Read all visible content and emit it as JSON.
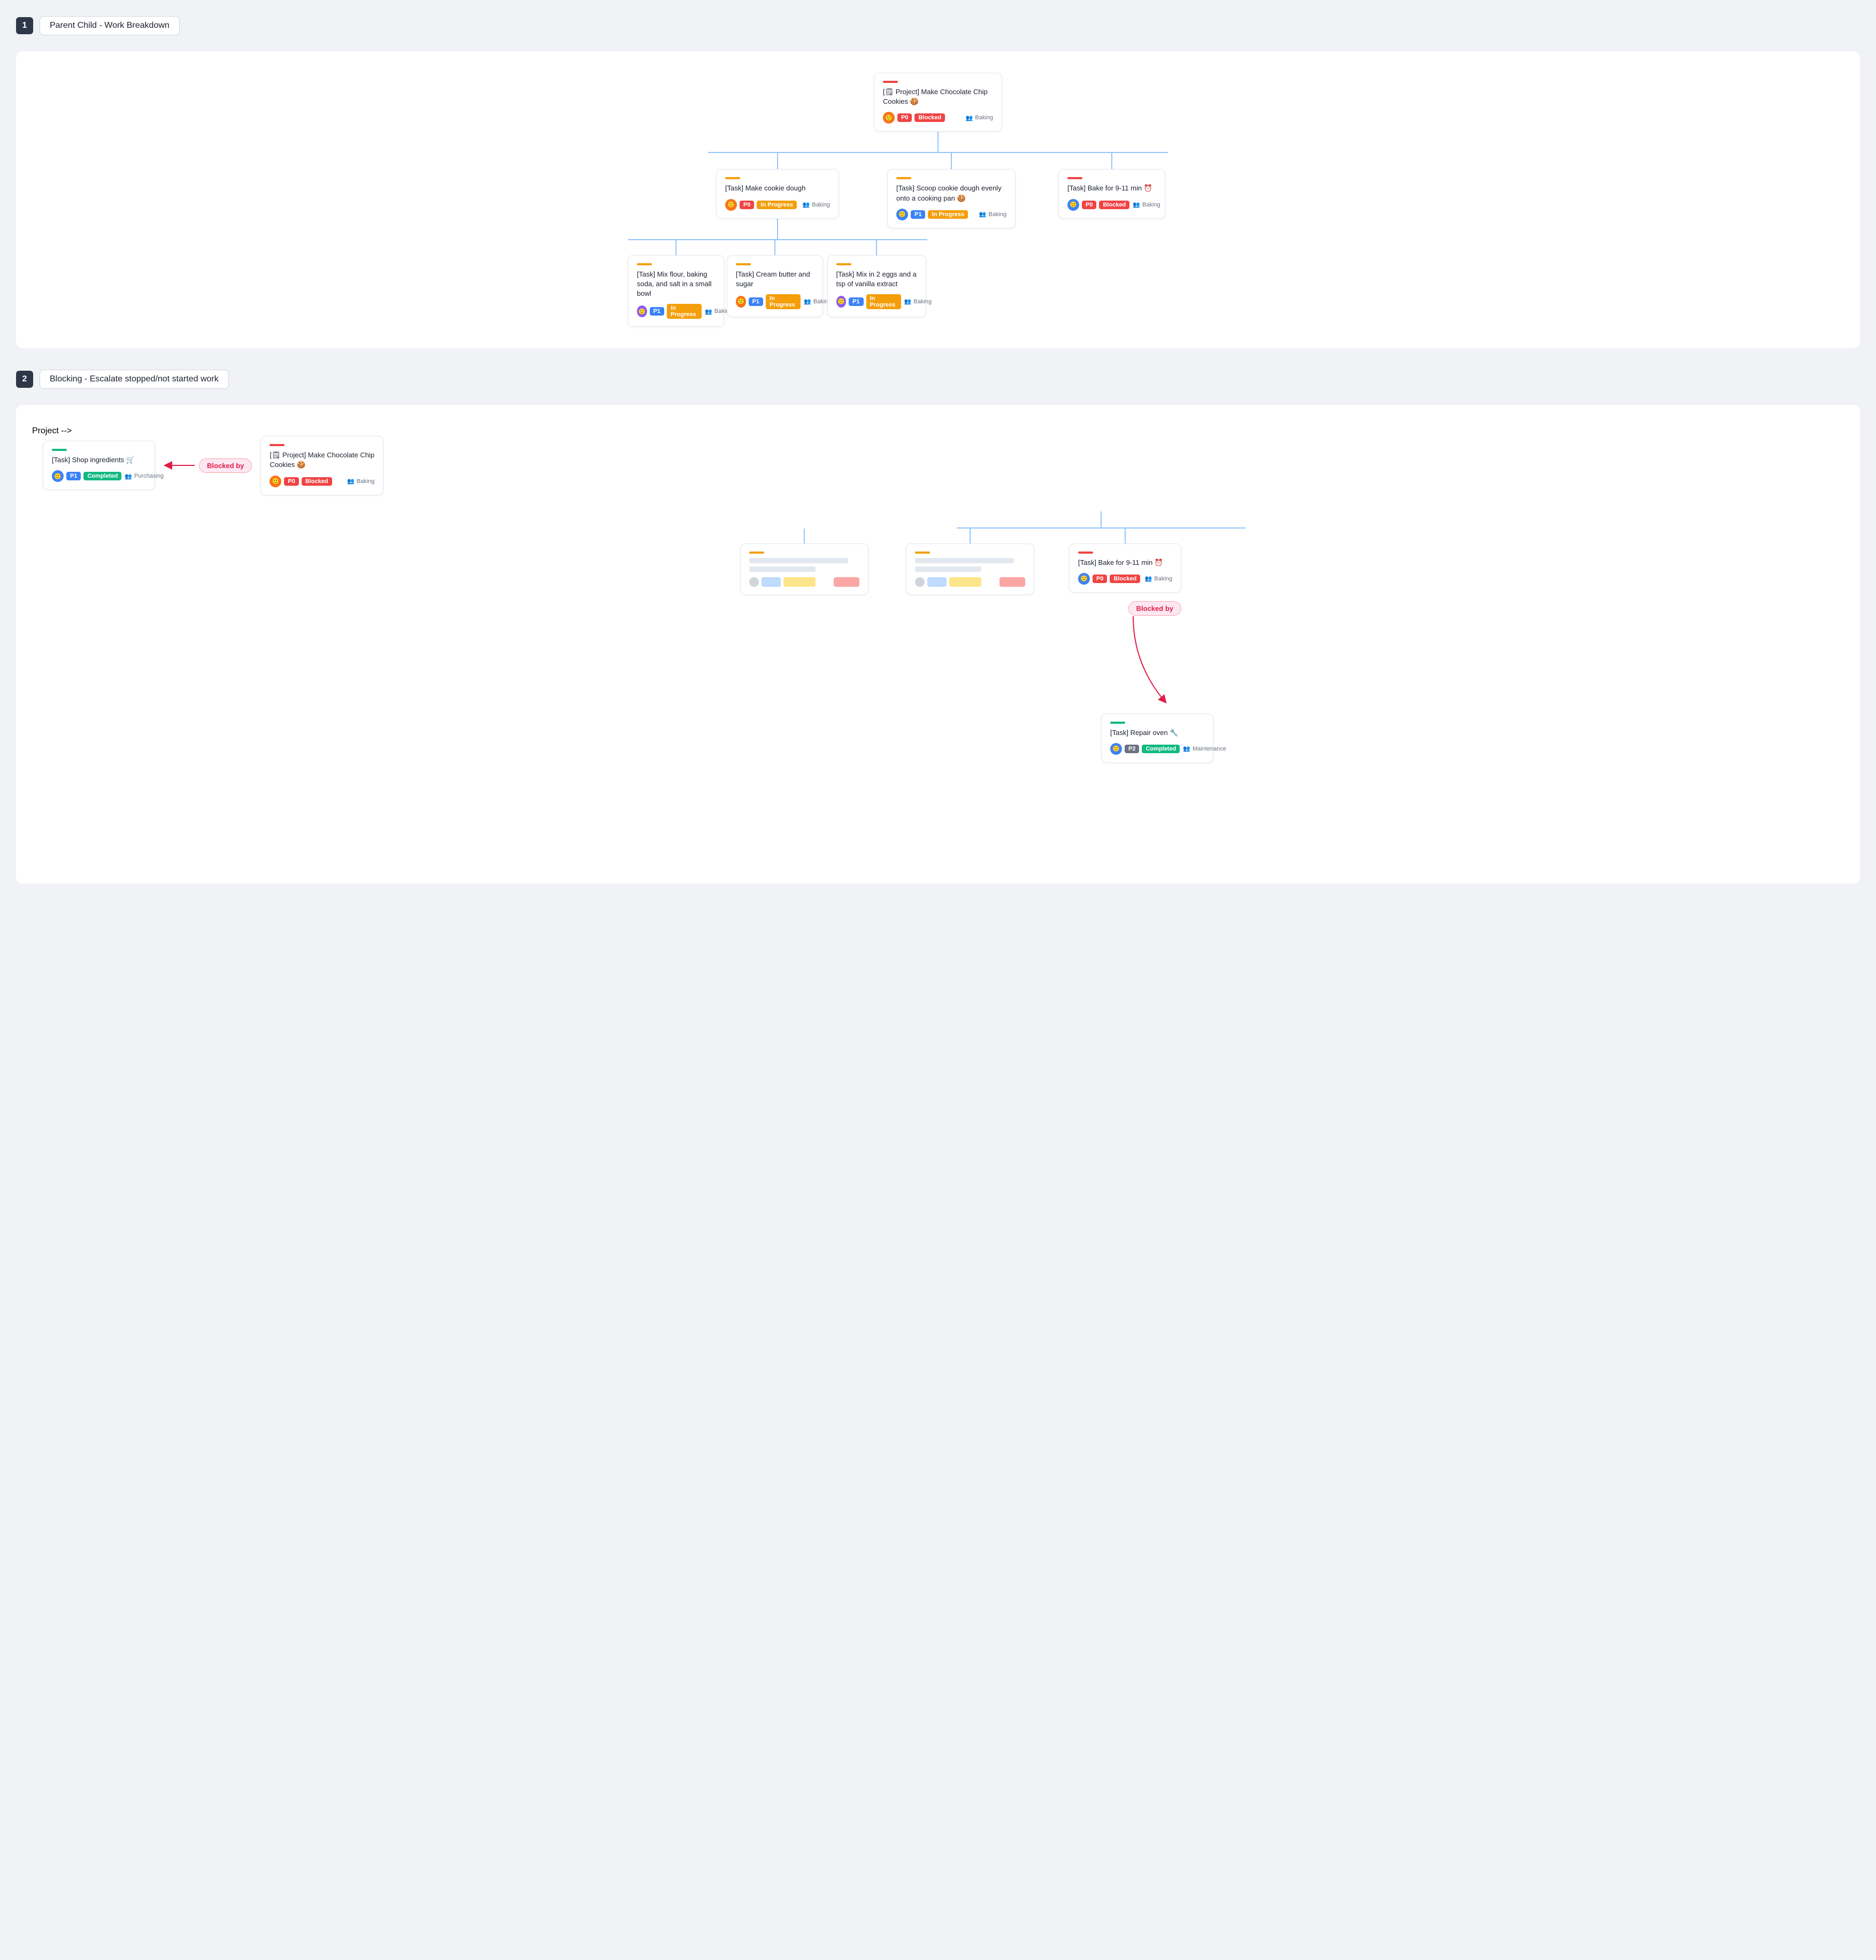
{
  "section1": {
    "number": "1",
    "title": "Parent Child - Work Breakdown",
    "root": {
      "accent": "accent-red",
      "title": "[🗒 Project] Make Chocolate Chip Cookies 🍪",
      "priority": "P0",
      "priority_class": "badge-p0",
      "status": "Blocked",
      "status_class": "badge-blocked",
      "team": "Baking"
    },
    "level2": [
      {
        "accent": "accent-yellow",
        "title": "[Task] Make cookie dough",
        "priority": "P0",
        "priority_class": "badge-p0",
        "status": "In Progress",
        "status_class": "badge-in-progress",
        "team": "Baking"
      },
      {
        "accent": "accent-yellow",
        "title": "[Task] Scoop cookie dough evenly onto a cooking pan 🍪",
        "priority": "P1",
        "priority_class": "badge-p1",
        "status": "In Progress",
        "status_class": "badge-in-progress",
        "team": "Baking"
      },
      {
        "accent": "accent-red",
        "title": "[Task] Bake for 9-11 min ⏰",
        "priority": "P0",
        "priority_class": "badge-p0",
        "status": "Blocked",
        "status_class": "badge-blocked",
        "team": "Baking"
      }
    ],
    "level3": [
      {
        "accent": "accent-yellow",
        "title": "[Task] Mix flour, baking soda, and salt in a small bowl",
        "priority": "P1",
        "priority_class": "badge-p1",
        "status": "In Progress",
        "status_class": "badge-in-progress",
        "team": "Baking"
      },
      {
        "accent": "accent-yellow",
        "title": "[Task] Cream butter and sugar",
        "priority": "P1",
        "priority_class": "badge-p1",
        "status": "In Progress",
        "status_class": "badge-in-progress",
        "team": "Baking"
      },
      {
        "accent": "accent-yellow",
        "title": "[Task] Mix in 2 eggs and a tsp of vanilla extract",
        "priority": "P1",
        "priority_class": "badge-p1",
        "status": "In Progress",
        "status_class": "badge-in-progress",
        "team": "Baking"
      }
    ]
  },
  "section2": {
    "number": "2",
    "title": "Blocking - Escalate stopped/not started work",
    "shop": {
      "accent": "accent-green",
      "title": "[Task] Shop ingredients 🛒",
      "priority": "P1",
      "priority_class": "badge-p1",
      "status": "Completed",
      "status_class": "badge-completed",
      "team": "Purchasing"
    },
    "blocked_by_label1": "Blocked by",
    "project": {
      "accent": "accent-red",
      "title": "[🗒 Project] Make Chocolate Chip Cookies 🍪",
      "priority": "P0",
      "priority_class": "badge-p0",
      "status": "Blocked",
      "status_class": "badge-blocked",
      "team": "Baking"
    },
    "bake": {
      "accent": "accent-red",
      "title": "[Task] Bake for 9-11 min ⏰",
      "priority": "P0",
      "priority_class": "badge-p0",
      "status": "Blocked",
      "status_class": "badge-blocked",
      "team": "Baking"
    },
    "blocked_by_label2": "Blocked by",
    "repair": {
      "accent": "accent-green",
      "title": "[Task] Repair oven 🔧",
      "priority": "P2",
      "priority_class": "badge-p2",
      "status": "Completed",
      "status_class": "badge-completed",
      "team": "Maintenance"
    }
  },
  "icons": {
    "person": "👤",
    "team": "👥"
  }
}
